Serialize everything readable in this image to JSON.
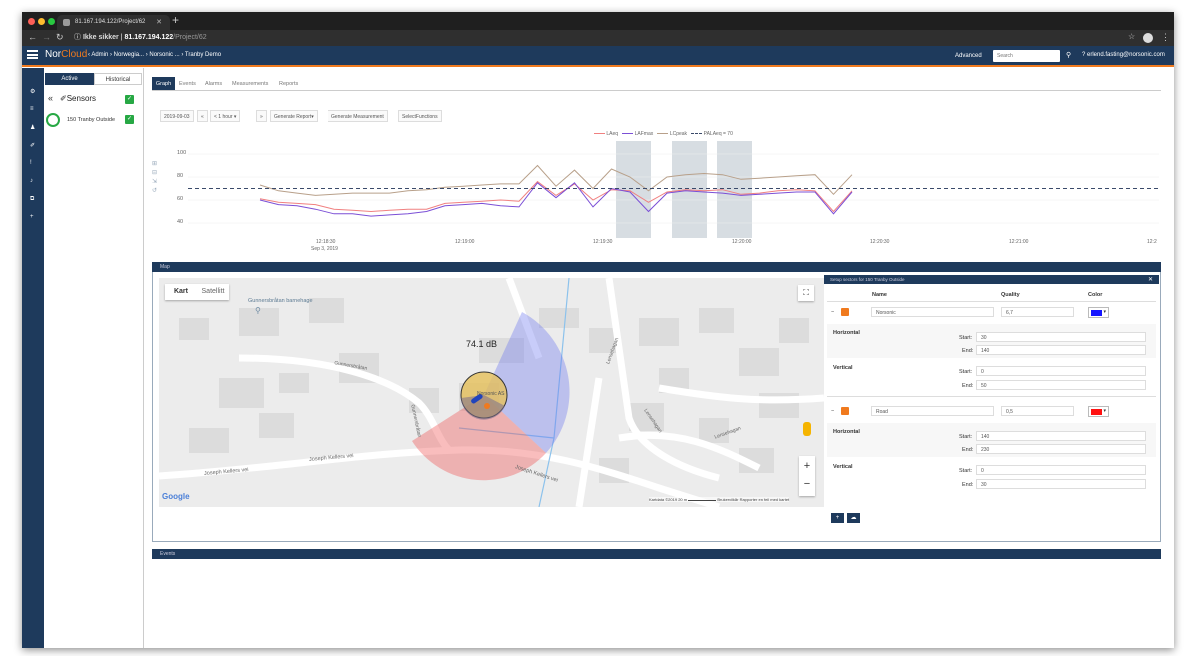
{
  "browser": {
    "tab_title": "81.167.194.122/Project/62",
    "url_security": "Ikke sikker",
    "url_host": "81.167.194.122",
    "url_path": "/Project/62"
  },
  "app": {
    "brand_a": "Nor",
    "brand_b": "Cloud",
    "breadcrumb": "Admin › Norwegia... › Norsonic ... › Tranby Demo",
    "advanced": "Advanced",
    "search_placeholder": "Search",
    "user": "erlend.fasting@norsonic.com"
  },
  "sidebar": {
    "tab_active": "Active",
    "tab_historical": "Historical",
    "sensors_label": "Sensors",
    "sensor_name": "150 Tranby Outside"
  },
  "tabs": [
    "Graph",
    "Events",
    "Alarms",
    "Measurements",
    "Reports"
  ],
  "toolbar": {
    "date": "2019-09-03",
    "prev": "«",
    "range": "< 1 hour",
    "next": "»",
    "gen_report": "Generate Report▾",
    "gen_meas": "Generate Measurement",
    "select_fn": "SelectFunctions"
  },
  "chart_data": {
    "type": "line",
    "y_ticks": [
      "100",
      "80",
      "60",
      "40"
    ],
    "ylim": [
      30,
      110
    ],
    "x_ticks": [
      "12:18:30",
      "12:19:00",
      "12:19:30",
      "12:20:00",
      "12:20:30",
      "12:21:00",
      "12:2"
    ],
    "x_date": "Sep 3, 2019",
    "legend": [
      "LAeq",
      "LAFmax",
      "LCpeak",
      "PALAeq = 70"
    ],
    "threshold": 70,
    "colors": {
      "LAeq": "#f08080",
      "LAFmax": "#7b4fd6",
      "LCpeak": "#b8a08a",
      "threshold": "#3a4a6a"
    },
    "series": [
      {
        "name": "LAeq",
        "values": [
          61,
          58,
          57,
          56,
          52,
          51,
          50,
          51,
          52,
          52,
          57,
          58,
          59,
          60,
          59,
          76,
          64,
          74,
          60,
          69,
          68,
          58,
          67,
          69,
          68,
          69,
          65,
          66,
          68,
          69,
          68,
          50,
          68
        ]
      },
      {
        "name": "LAFmax",
        "values": [
          60,
          56,
          55,
          52,
          48,
          48,
          46,
          47,
          48,
          50,
          55,
          56,
          57,
          55,
          54,
          75,
          62,
          75,
          54,
          70,
          67,
          50,
          66,
          68,
          67,
          66,
          64,
          65,
          66,
          67,
          67,
          48,
          67
        ]
      },
      {
        "name": "LCpeak",
        "values": [
          73,
          68,
          66,
          64,
          65,
          66,
          66,
          66,
          68,
          69,
          71,
          72,
          73,
          74,
          74,
          90,
          72,
          86,
          70,
          87,
          80,
          68,
          80,
          82,
          83,
          82,
          78,
          79,
          80,
          81,
          82,
          65,
          82
        ]
      }
    ]
  },
  "map": {
    "section_label": "Map",
    "kart": "Kart",
    "satellitt": "Satellitt",
    "poi": "Gunnersbråtan barnehage",
    "db": "74.1 dB",
    "streets": [
      "Gunnersbråtan",
      "Joseph Kellers vei",
      "Joseph Kellers vei",
      "Joseph Kellers vei",
      "Gunnersbråtan",
      "Lensehagan",
      "Lensehagan",
      "Lensehagan"
    ],
    "place": "Norsonic AS",
    "attribution": "Kartdata ©2019   20 m",
    "attribution2": "Brukervilkår   Rapporter en feil med kartet",
    "google": "Google"
  },
  "setup": {
    "title": "Setup sectors for 150 Tranby Outside",
    "col_name": "Name",
    "col_quality": "Quality",
    "col_color": "Color",
    "sectors": [
      {
        "name": "Norsonic",
        "quality": "6,7",
        "color": "#1515ff",
        "h_start": "30",
        "h_end": "140",
        "v_start": "0",
        "v_end": "50"
      },
      {
        "name": "Road",
        "quality": "0,5",
        "color": "#ff1010",
        "h_start": "140",
        "h_end": "230",
        "v_start": "0",
        "v_end": "30"
      }
    ],
    "horizontal": "Horizontal",
    "vertical": "Vertical",
    "start": "Start:",
    "end": "End:"
  },
  "events_bar": "Events"
}
